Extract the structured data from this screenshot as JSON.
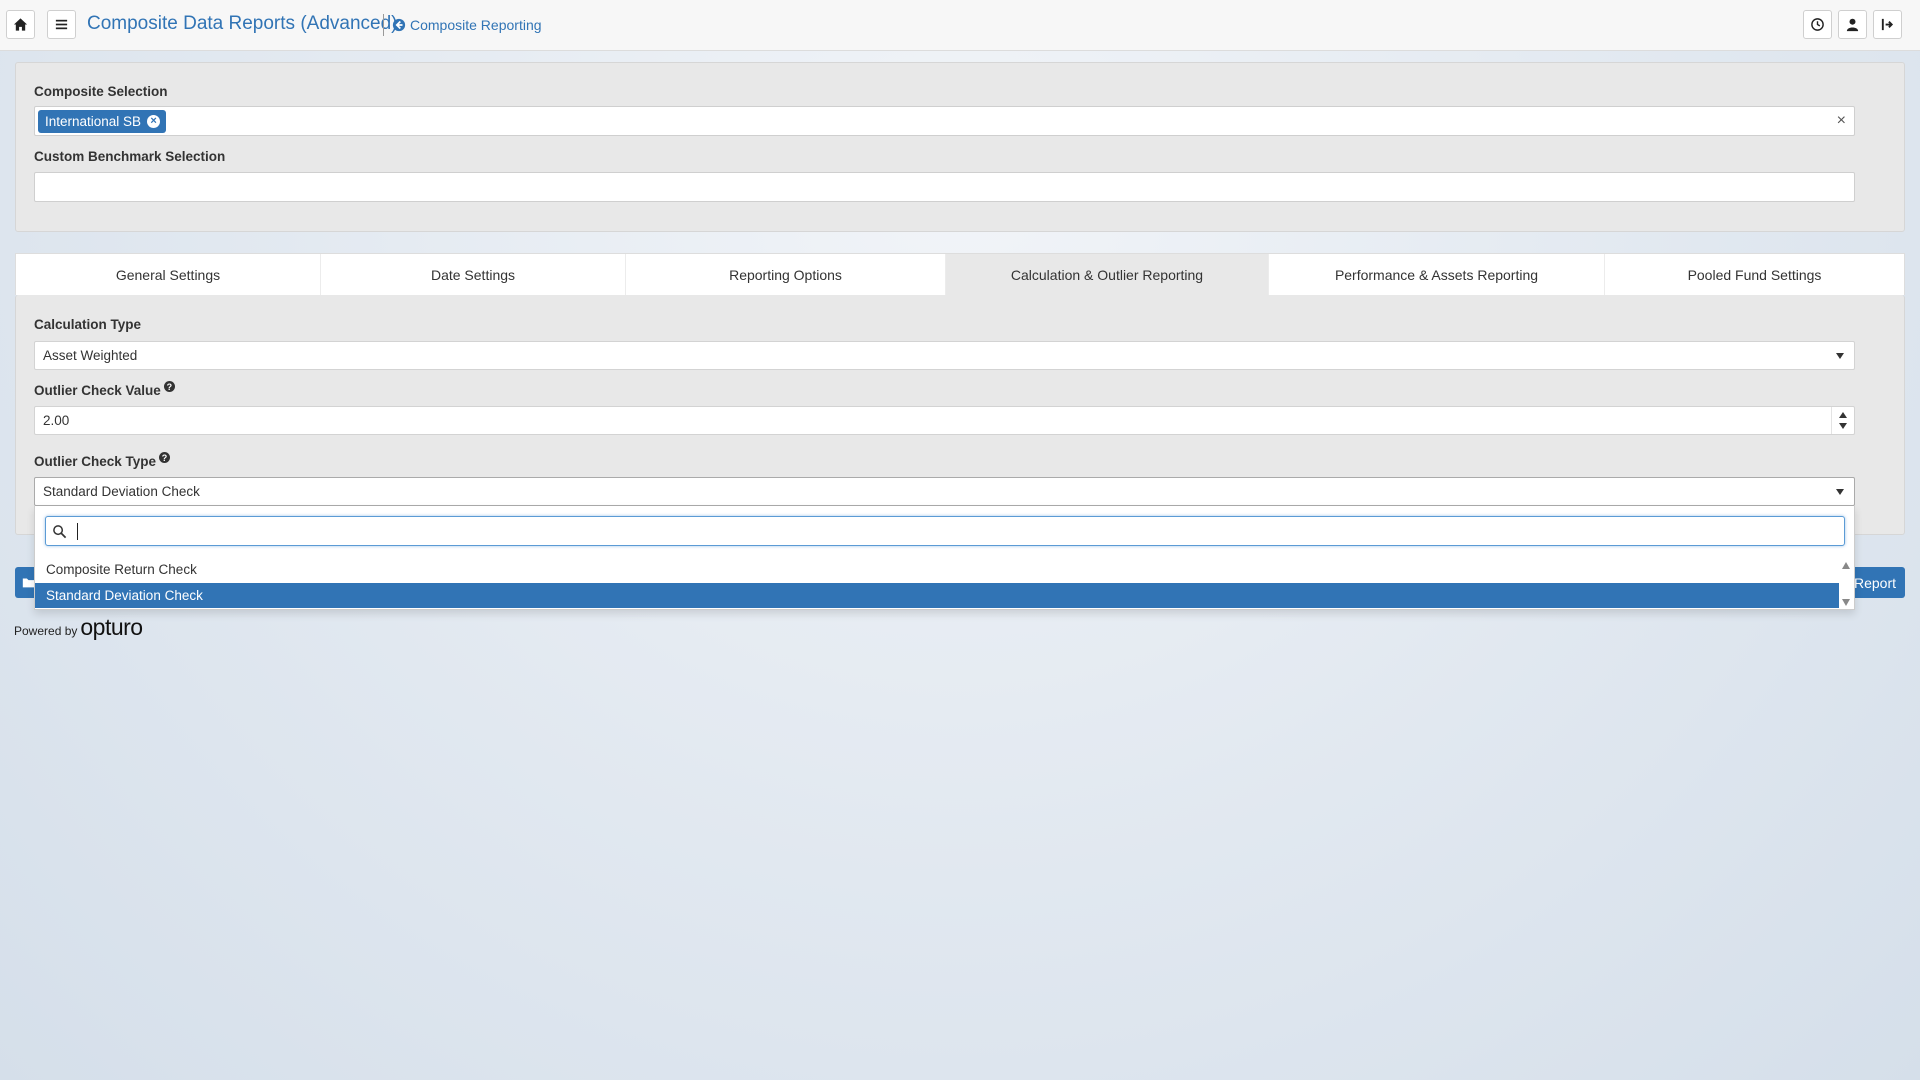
{
  "header": {
    "title": "Composite Data Reports (Advanced)",
    "back_link": "Composite Reporting",
    "icons": [
      "home-icon",
      "menu-icon",
      "history-icon",
      "user-icon",
      "logout-icon"
    ]
  },
  "composite_selection": {
    "label": "Composite Selection",
    "selected_tags": [
      "International SB"
    ]
  },
  "benchmark_selection": {
    "label": "Custom Benchmark Selection",
    "value": ""
  },
  "tabs": [
    {
      "label": "General Settings"
    },
    {
      "label": "Date Settings"
    },
    {
      "label": "Reporting Options"
    },
    {
      "label": "Calculation & Outlier Reporting"
    },
    {
      "label": "Performance & Assets Reporting"
    },
    {
      "label": "Pooled Fund Settings"
    }
  ],
  "calculation": {
    "type_label": "Calculation Type",
    "type_value": "Asset Weighted",
    "outlier_value_label": "Outlier Check Value",
    "outlier_value": "2.00",
    "outlier_type_label": "Outlier Check Type",
    "outlier_type_value": "Standard Deviation Check",
    "help_glyph": "?"
  },
  "dropdown": {
    "search_value": "",
    "options": [
      "Composite Return Check",
      "Standard Deviation Check"
    ],
    "selected_option": "Standard Deviation Check"
  },
  "actions": {
    "run_report_visible": "Report"
  },
  "footer": {
    "powered_by": "Powered by",
    "brand": "opturo"
  },
  "colors": {
    "accent": "#3174b5",
    "panel": "#e8e8e8"
  }
}
